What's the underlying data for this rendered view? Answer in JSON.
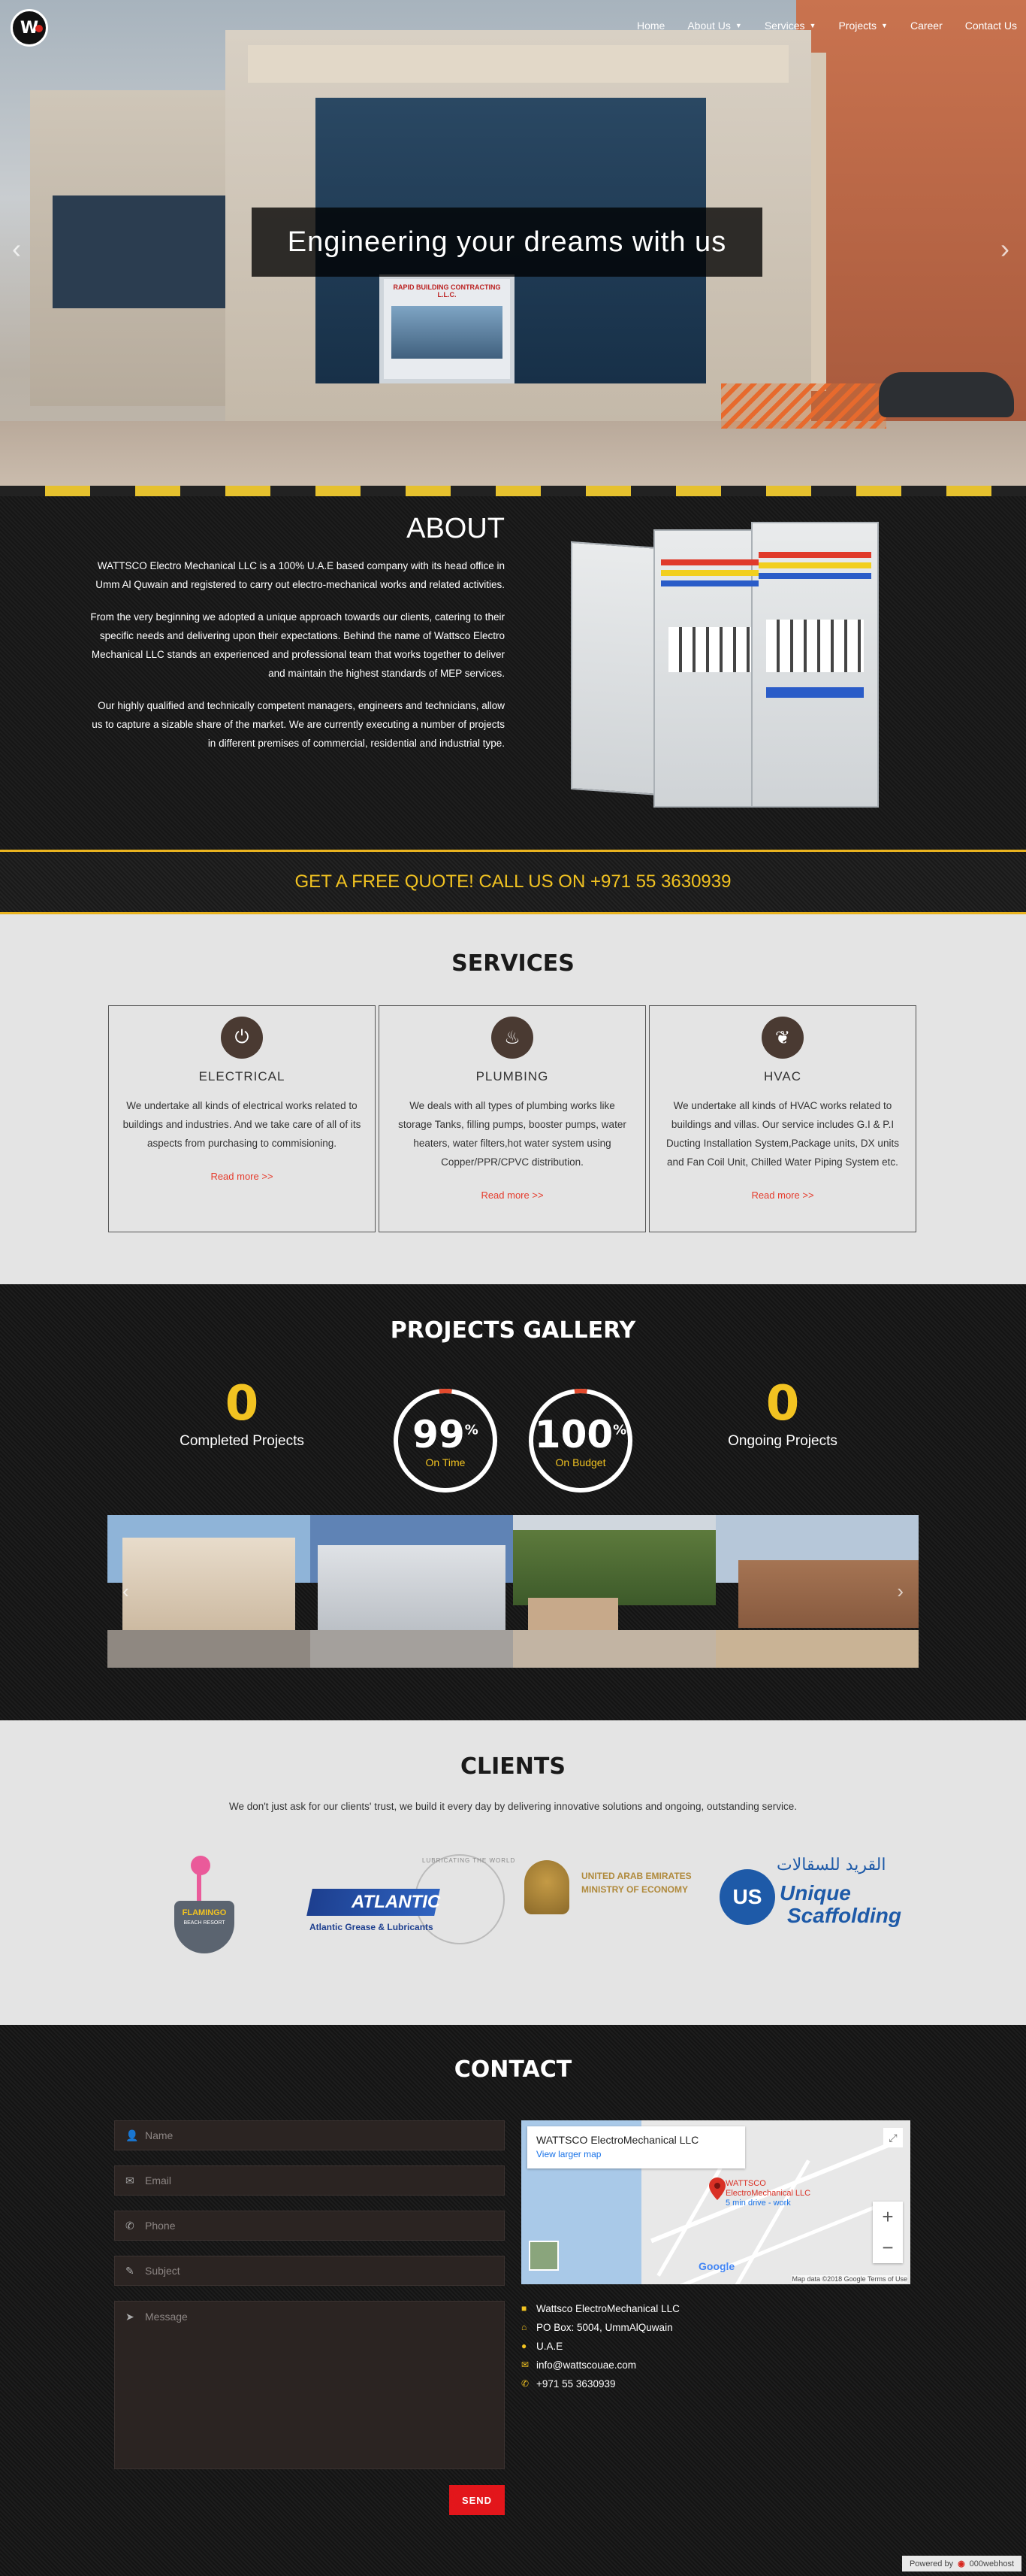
{
  "header": {
    "logo_letter": "W",
    "nav": [
      {
        "label": "Home",
        "has_dropdown": false
      },
      {
        "label": "About Us",
        "has_dropdown": true
      },
      {
        "label": "Services",
        "has_dropdown": true
      },
      {
        "label": "Projects",
        "has_dropdown": true
      },
      {
        "label": "Career",
        "has_dropdown": false
      },
      {
        "label": "Contact Us",
        "has_dropdown": false
      }
    ],
    "slider_caption": "Engineering your dreams with us",
    "building_sign": "RAPID BUILDING CONTRACTING L.L.C.",
    "prev_icon": "chevron-left-icon",
    "next_icon": "chevron-right-icon"
  },
  "about": {
    "title": "ABOUT",
    "paragraphs": [
      "WATTSCO Electro Mechanical LLC is a 100% U.A.E based company with its head office in Umm Al Quwain and registered to carry out electro-mechanical works and related activities.",
      "From the very beginning we adopted a unique approach towards our clients, catering to their specific needs and delivering upon their expectations. Behind the name of Wattsco Electro Mechanical LLC stands an experienced and professional team that works together to deliver and maintain the highest standards of MEP services.",
      "Our highly qualified and technically competent managers, engineers and technicians, allow us to capture a sizable share of the market. We are currently executing a number of projects in different premises of commercial, residential and industrial type."
    ]
  },
  "quote_banner": "GET A FREE QUOTE! CALL US ON +971 55 3630939",
  "services": {
    "title": "SERVICES",
    "items": [
      {
        "icon": "plug-icon",
        "title": "ELECTRICAL",
        "text": "We undertake all kinds of electrical works related to buildings and industries. And we take care of all of its aspects from purchasing to commisioning.",
        "link": "Read more >>"
      },
      {
        "icon": "bathtub-icon",
        "title": "PLUMBING",
        "text": "We deals with all types of plumbing works like storage Tanks, filling pumps, booster pumps, water heaters, water filters,hot water system using Copper/PPR/CPVC distribution.",
        "link": "Read more >>"
      },
      {
        "icon": "leaf-icon",
        "title": "HVAC",
        "text": "We undertake all kinds of HVAC works related to buildings and villas. Our service includes G.I & P.I Ducting Installation System,Package units, DX units and Fan Coil Unit, Chilled Water Piping System etc.",
        "link": "Read more >>"
      }
    ]
  },
  "projects": {
    "title": "PROJECTS GALLERY",
    "completed": {
      "value": "0",
      "label": "Completed Projects"
    },
    "on_time": {
      "value": "99",
      "percent": 99,
      "label": "On Time"
    },
    "on_budget": {
      "value": "100",
      "percent": 100,
      "label": "On Budget"
    },
    "ongoing": {
      "value": "0",
      "label": "Ongoing Projects"
    },
    "percent_sign": "%"
  },
  "clients": {
    "title": "CLIENTS",
    "tagline": "We don't just ask for our clients' trust, we build it every day by delivering innovative solutions and ongoing, outstanding service.",
    "logos": [
      {
        "name": "flamingo",
        "text": "FLAMINGO",
        "sub": "BEACH RESORT"
      },
      {
        "name": "atlantic",
        "text": "ATLANTIC",
        "sub": "Atlantic Grease & Lubricants",
        "ring": "LUBRICATING THE WORLD"
      },
      {
        "name": "uae-economy",
        "text": "UNITED ARAB EMIRATES",
        "sub": "MINISTRY OF ECONOMY"
      },
      {
        "name": "unique-scaffolding",
        "text": "Unique",
        "sub": "Scaffolding"
      }
    ]
  },
  "contact": {
    "title": "CONTACT",
    "fields": {
      "name": "Name",
      "email": "Email",
      "phone": "Phone",
      "subject": "Subject",
      "message": "Message"
    },
    "send_label": "SEND",
    "map": {
      "place_title": "WATTSCO ElectroMechanical LLC",
      "larger_map": "View larger map",
      "pin_label_1": "WATTSCO",
      "pin_label_2": "ElectroMechanical LLC",
      "pin_label_3": "5 min drive - work",
      "attribution": "Map data ©2018 Google   Terms of Use",
      "google": "Google"
    },
    "info": [
      {
        "icon": "briefcase-icon",
        "text": "Wattsco ElectroMechanical LLC"
      },
      {
        "icon": "home-icon",
        "text": "PO Box: 5004, UmmAlQuwain"
      },
      {
        "icon": "map-marker-icon",
        "text": "U.A.E"
      },
      {
        "icon": "envelope-icon",
        "text": "info@wattscouae.com"
      },
      {
        "icon": "phone-icon",
        "text": "+971 55 3630939"
      }
    ]
  },
  "footer": {
    "powered_by": "Powered by",
    "host": "000webhost"
  },
  "colors": {
    "accent": "#f2c321",
    "send": "#e3161b",
    "link": "#e53b2c"
  }
}
